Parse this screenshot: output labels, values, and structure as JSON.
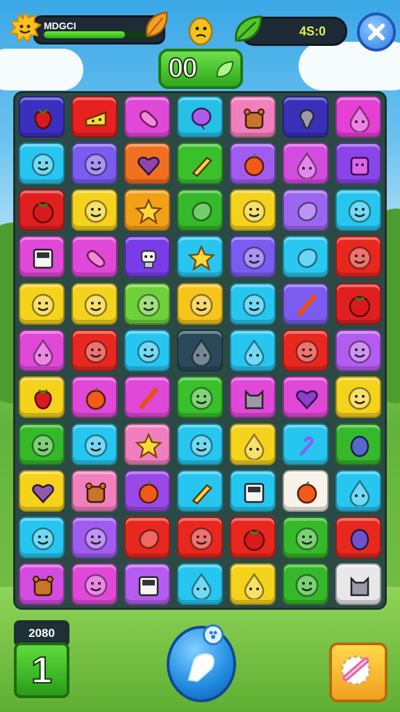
{
  "hud": {
    "player_label": "MDGCI",
    "progress": 0.78,
    "timer": "4S:0",
    "score": "00",
    "close_icon": "close-icon"
  },
  "level": {
    "count": "2080",
    "number": "1"
  },
  "board": {
    "rows": 11,
    "cols": 7,
    "tiles": [
      [
        "#3b2fc0:strawberry",
        "#e8201f:cheese",
        "#e048d8:bean",
        "#25c0e6:balloon",
        "#f27fbd:bear",
        "#3a2fb8:pear",
        "#e53fd6:drop"
      ],
      [
        "#27c6f0:smile",
        "#7a5cf0:smile",
        "#f07020:heart",
        "#39c12c:pin",
        "#a05bf0:orange",
        "#d44be0:drop",
        "#8a45e8:block"
      ],
      [
        "#e02020:tomato",
        "#f5d21c:smile",
        "#f3a019:star",
        "#35b82a:blob",
        "#f5d21c:smile",
        "#9c67f0:blob",
        "#27c6f0:smile"
      ],
      [
        "#e048d8:calc",
        "#e048d8:bean",
        "#7a3ce8:robot",
        "#27c6f0:star",
        "#7a5cf0:smile",
        "#29c8f0:blob",
        "#e8281f:smile"
      ],
      [
        "#f5d21c:smile",
        "#f5d21c:smile",
        "#6fd03a:smile",
        "#f6c51c:smile",
        "#27c6f0:smile",
        "#7a5cf0:stick",
        "#e02020:tomato"
      ],
      [
        "#e048d8:drop",
        "#e8281f:smile",
        "#27c6f0:smile",
        "#2a4a5a:drop",
        "#27c6f0:drop",
        "#e8281f:smile",
        "#b55cf0:smile"
      ],
      [
        "#f5d21c:strawberry",
        "#e048d8:orange",
        "#e048d8:stick",
        "#39c12c:smile",
        "#e048d8:cat",
        "#e048d8:heart",
        "#f5d21c:smile"
      ],
      [
        "#35b82a:smile",
        "#27c6f0:smile",
        "#f27fbd:star",
        "#27c6f0:smile",
        "#f5d21c:drop",
        "#27c6f0:hook",
        "#35b82a:egg"
      ],
      [
        "#f5d21c:heart",
        "#f27fbd:bear",
        "#9a48e8:orange",
        "#27c6f0:pin",
        "#27c6f0:calc",
        "#f8f2e8:orange",
        "#27c6f0:drop"
      ],
      [
        "#27c6f0:smile",
        "#a05bf0:smile",
        "#e8281f:blob",
        "#e8281f:smile",
        "#e8281f:tomato",
        "#35b82a:smile",
        "#e8281f:egg"
      ],
      [
        "#d44be0:bear",
        "#e048d8:smile",
        "#b55cf0:calc",
        "#27c6f0:drop",
        "#f5d21c:drop",
        "#35b82a:smile",
        "#e8e8e8:cat"
      ]
    ]
  }
}
